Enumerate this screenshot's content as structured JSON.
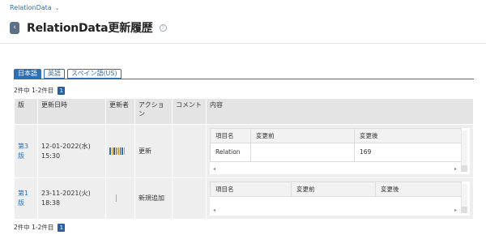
{
  "breadcrumb": {
    "label": "RelationData",
    "chevron": "chevron-down-icon"
  },
  "header": {
    "title": "RelationData更新履歴",
    "back_icon": "back-icon",
    "help_icon": "help-icon"
  },
  "tabs": [
    {
      "label": "日本語",
      "active": true
    },
    {
      "label": "英語",
      "active": false
    },
    {
      "label": "スペイン語(US)",
      "active": false
    }
  ],
  "pagination": {
    "summary": "2件中 1-2件目",
    "current_page": "1"
  },
  "table": {
    "headers": [
      "版",
      "更新日時",
      "更新者",
      "アクション",
      "コメント",
      "内容"
    ],
    "rows": [
      {
        "version": "第3版",
        "date": "12-01-2022(水)",
        "time": "15:30",
        "action": "更新",
        "comment": "",
        "content": {
          "headers": [
            "項目名",
            "変更前",
            "変更後"
          ],
          "rows": [
            {
              "item": "Relation",
              "before": "",
              "after": "169"
            }
          ]
        }
      },
      {
        "version": "第1版",
        "date": "23-11-2021(火)",
        "time": "18:38",
        "action": "新規追加",
        "comment": "",
        "content": {
          "headers": [
            "項目名",
            "変更前",
            "変更後"
          ],
          "rows": []
        }
      }
    ]
  },
  "colors": {
    "accent": "#2f6fb2",
    "header_bg": "#e4e4e4",
    "row_bg": "#eeeeee"
  }
}
